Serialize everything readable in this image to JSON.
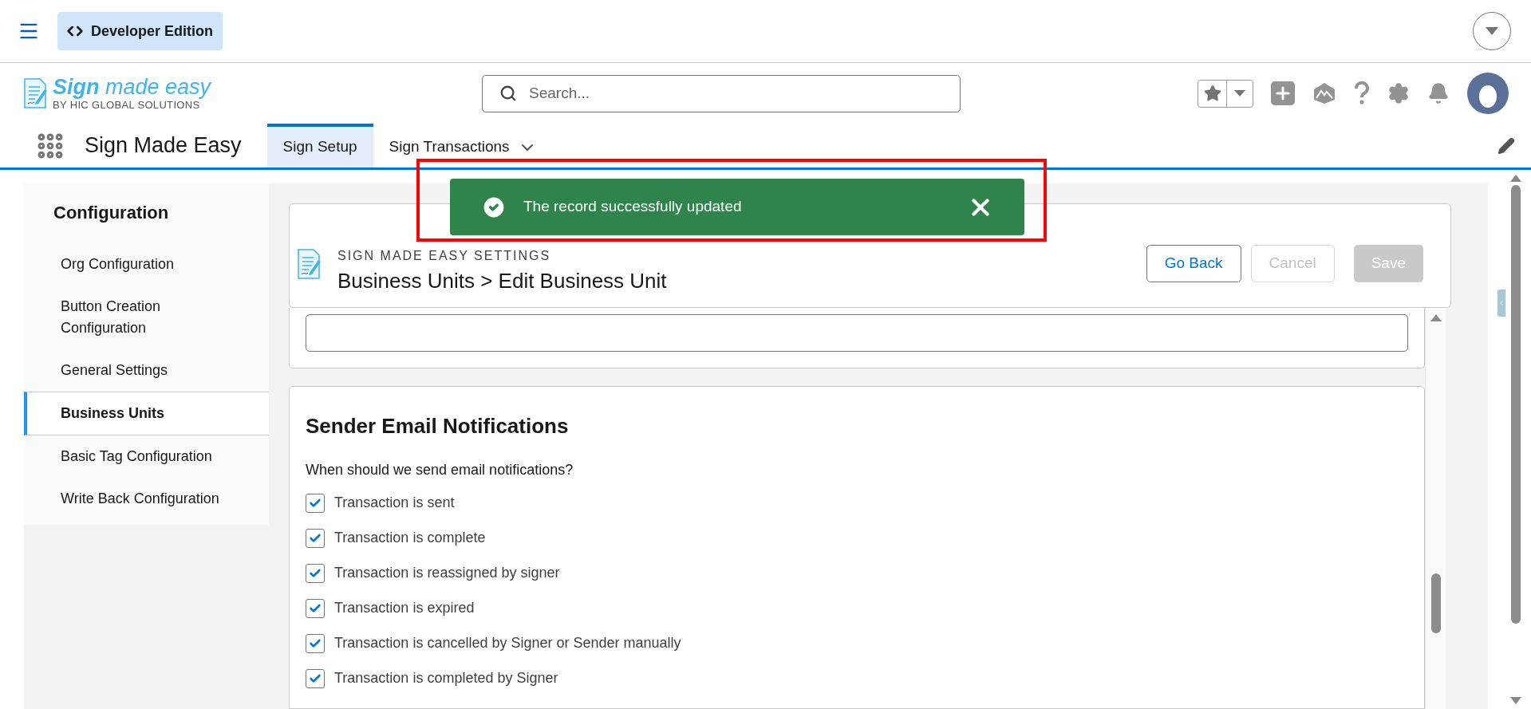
{
  "top_bar": {
    "app_chip": "Developer Edition"
  },
  "header": {
    "logo": {
      "name": "**Sign** made easy",
      "tagline": "BY HIC GLOBAL SOLUTIONS"
    },
    "search": {
      "placeholder": "Search..."
    }
  },
  "nav": {
    "app_name": "Sign Made Easy",
    "tabs": [
      {
        "label": "Sign Setup",
        "selected": true,
        "has_menu": false
      },
      {
        "label": "Sign Transactions",
        "selected": false,
        "has_menu": true
      }
    ]
  },
  "sidebar": {
    "title": "Configuration",
    "items": [
      {
        "label": "Org Configuration",
        "selected": false
      },
      {
        "label": "Button Creation Configuration",
        "selected": false
      },
      {
        "label": "General Settings",
        "selected": false
      },
      {
        "label": "Business Units",
        "selected": true
      },
      {
        "label": "Basic Tag Configuration",
        "selected": false
      },
      {
        "label": "Write Back Configuration",
        "selected": false
      }
    ]
  },
  "page_header": {
    "eyebrow": "SIGN MADE EASY SETTINGS",
    "title": "Business Units > Edit Business Unit",
    "buttons": [
      {
        "label": "Go Back",
        "kind": "outline",
        "disabled": false
      },
      {
        "label": "Cancel",
        "kind": "outline",
        "disabled": true
      },
      {
        "label": "Save",
        "kind": "brand",
        "disabled": true
      }
    ]
  },
  "notifications": {
    "title": "Sender Email Notifications",
    "question": "When should we send email notifications?",
    "options": [
      {
        "label": "Transaction is sent",
        "checked": true
      },
      {
        "label": "Transaction is complete",
        "checked": true
      },
      {
        "label": "Transaction is reassigned by signer",
        "checked": true
      },
      {
        "label": "Transaction is expired",
        "checked": true
      },
      {
        "label": "Transaction is cancelled by Signer or Sender manually",
        "checked": true
      },
      {
        "label": "Transaction is completed by Signer",
        "checked": true
      }
    ]
  },
  "toast": {
    "kind": "success",
    "message": "The record successfully updated"
  }
}
